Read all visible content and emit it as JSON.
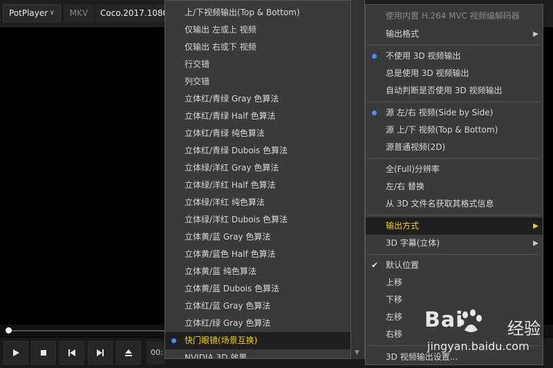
{
  "titlebar": {
    "app_name": "PotPlayer",
    "format": "MKV",
    "file_name": "Coco.2017.1080"
  },
  "controls": {
    "time": "00:"
  },
  "submenu": {
    "items": [
      "上/下视频输出(Top & Bottom)",
      "仅输出 左或上 视频",
      "仅输出 右或下 视频",
      "行交错",
      "列交错",
      "立体红/青绿 Gray 色算法",
      "立体红/青绿 Half 色算法",
      "立体红/青绿 纯色算法",
      "立体红/青绿 Dubois 色算法",
      "立体绿/洋红 Gray 色算法",
      "立体绿/洋红 Half 色算法",
      "立体绿/洋红 纯色算法",
      "立体绿/洋红 Dubois 色算法",
      "立体黄/蓝 Gray 色算法",
      "立体黄/蓝色 Half 色算法",
      "立体黄/蓝 纯色算法",
      "立体黄/蓝 Dubois 色算法",
      "立体红/蓝 Gray 色算法",
      "立体红/绿 Gray 色算法",
      "快门眼镜(场景互换)",
      "NVIDIA 3D 效果"
    ],
    "selected_index": 19
  },
  "mainmenu": {
    "items": {
      "mvc_decoder": "使用内置 H.264 MVC 视频编解码器",
      "output_format": "输出格式",
      "no_3d": "不使用 3D 视频输出",
      "always_3d": "总是使用 3D 视频输出",
      "auto_3d": "自动判断是否使用 3D 视频输出",
      "src_sbs": "源 左/右 视频(Side by Side)",
      "src_tb": "源 上/下 视频(Top & Bottom)",
      "src_2d": "源普通视频(2D)",
      "full_res": "全(Full)分辨率",
      "swap_lr": "左/右 替换",
      "from_filename": "从 3D 文件名获取其格式信息",
      "output_method": "输出方式",
      "subtitle_3d": "3D 字幕(立体)",
      "default_pos": "默认位置",
      "up": "上移",
      "down": "下移",
      "left": "左移",
      "right": "右移",
      "settings": "3D 视频输出设置..."
    }
  },
  "watermark": {
    "logo": "Bai",
    "logo_tail": "经验",
    "url": "jingyan.baidu.com"
  },
  "colors": {
    "highlight_text": "#f5d400",
    "radio_dot": "#4a8cff",
    "menu_bg": "#3a3a3a"
  }
}
